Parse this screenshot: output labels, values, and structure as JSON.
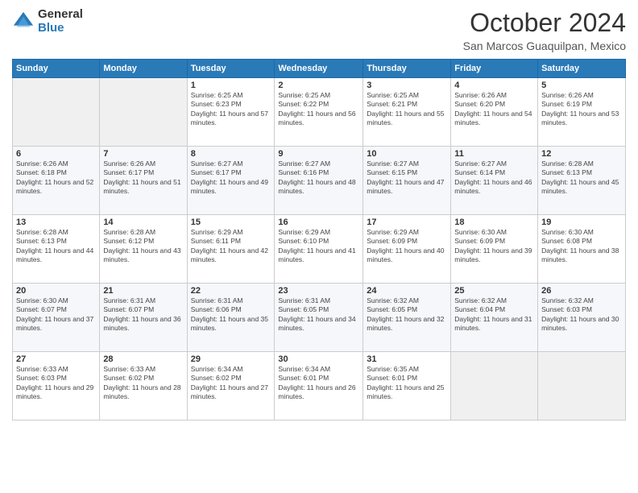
{
  "logo": {
    "general": "General",
    "blue": "Blue"
  },
  "title": "October 2024",
  "location": "San Marcos Guaquilpan, Mexico",
  "weekdays": [
    "Sunday",
    "Monday",
    "Tuesday",
    "Wednesday",
    "Thursday",
    "Friday",
    "Saturday"
  ],
  "weeks": [
    [
      {
        "day": "",
        "sunrise": "",
        "sunset": "",
        "daylight": ""
      },
      {
        "day": "",
        "sunrise": "",
        "sunset": "",
        "daylight": ""
      },
      {
        "day": "1",
        "sunrise": "Sunrise: 6:25 AM",
        "sunset": "Sunset: 6:23 PM",
        "daylight": "Daylight: 11 hours and 57 minutes."
      },
      {
        "day": "2",
        "sunrise": "Sunrise: 6:25 AM",
        "sunset": "Sunset: 6:22 PM",
        "daylight": "Daylight: 11 hours and 56 minutes."
      },
      {
        "day": "3",
        "sunrise": "Sunrise: 6:25 AM",
        "sunset": "Sunset: 6:21 PM",
        "daylight": "Daylight: 11 hours and 55 minutes."
      },
      {
        "day": "4",
        "sunrise": "Sunrise: 6:26 AM",
        "sunset": "Sunset: 6:20 PM",
        "daylight": "Daylight: 11 hours and 54 minutes."
      },
      {
        "day": "5",
        "sunrise": "Sunrise: 6:26 AM",
        "sunset": "Sunset: 6:19 PM",
        "daylight": "Daylight: 11 hours and 53 minutes."
      }
    ],
    [
      {
        "day": "6",
        "sunrise": "Sunrise: 6:26 AM",
        "sunset": "Sunset: 6:18 PM",
        "daylight": "Daylight: 11 hours and 52 minutes."
      },
      {
        "day": "7",
        "sunrise": "Sunrise: 6:26 AM",
        "sunset": "Sunset: 6:17 PM",
        "daylight": "Daylight: 11 hours and 51 minutes."
      },
      {
        "day": "8",
        "sunrise": "Sunrise: 6:27 AM",
        "sunset": "Sunset: 6:17 PM",
        "daylight": "Daylight: 11 hours and 49 minutes."
      },
      {
        "day": "9",
        "sunrise": "Sunrise: 6:27 AM",
        "sunset": "Sunset: 6:16 PM",
        "daylight": "Daylight: 11 hours and 48 minutes."
      },
      {
        "day": "10",
        "sunrise": "Sunrise: 6:27 AM",
        "sunset": "Sunset: 6:15 PM",
        "daylight": "Daylight: 11 hours and 47 minutes."
      },
      {
        "day": "11",
        "sunrise": "Sunrise: 6:27 AM",
        "sunset": "Sunset: 6:14 PM",
        "daylight": "Daylight: 11 hours and 46 minutes."
      },
      {
        "day": "12",
        "sunrise": "Sunrise: 6:28 AM",
        "sunset": "Sunset: 6:13 PM",
        "daylight": "Daylight: 11 hours and 45 minutes."
      }
    ],
    [
      {
        "day": "13",
        "sunrise": "Sunrise: 6:28 AM",
        "sunset": "Sunset: 6:13 PM",
        "daylight": "Daylight: 11 hours and 44 minutes."
      },
      {
        "day": "14",
        "sunrise": "Sunrise: 6:28 AM",
        "sunset": "Sunset: 6:12 PM",
        "daylight": "Daylight: 11 hours and 43 minutes."
      },
      {
        "day": "15",
        "sunrise": "Sunrise: 6:29 AM",
        "sunset": "Sunset: 6:11 PM",
        "daylight": "Daylight: 11 hours and 42 minutes."
      },
      {
        "day": "16",
        "sunrise": "Sunrise: 6:29 AM",
        "sunset": "Sunset: 6:10 PM",
        "daylight": "Daylight: 11 hours and 41 minutes."
      },
      {
        "day": "17",
        "sunrise": "Sunrise: 6:29 AM",
        "sunset": "Sunset: 6:09 PM",
        "daylight": "Daylight: 11 hours and 40 minutes."
      },
      {
        "day": "18",
        "sunrise": "Sunrise: 6:30 AM",
        "sunset": "Sunset: 6:09 PM",
        "daylight": "Daylight: 11 hours and 39 minutes."
      },
      {
        "day": "19",
        "sunrise": "Sunrise: 6:30 AM",
        "sunset": "Sunset: 6:08 PM",
        "daylight": "Daylight: 11 hours and 38 minutes."
      }
    ],
    [
      {
        "day": "20",
        "sunrise": "Sunrise: 6:30 AM",
        "sunset": "Sunset: 6:07 PM",
        "daylight": "Daylight: 11 hours and 37 minutes."
      },
      {
        "day": "21",
        "sunrise": "Sunrise: 6:31 AM",
        "sunset": "Sunset: 6:07 PM",
        "daylight": "Daylight: 11 hours and 36 minutes."
      },
      {
        "day": "22",
        "sunrise": "Sunrise: 6:31 AM",
        "sunset": "Sunset: 6:06 PM",
        "daylight": "Daylight: 11 hours and 35 minutes."
      },
      {
        "day": "23",
        "sunrise": "Sunrise: 6:31 AM",
        "sunset": "Sunset: 6:05 PM",
        "daylight": "Daylight: 11 hours and 34 minutes."
      },
      {
        "day": "24",
        "sunrise": "Sunrise: 6:32 AM",
        "sunset": "Sunset: 6:05 PM",
        "daylight": "Daylight: 11 hours and 32 minutes."
      },
      {
        "day": "25",
        "sunrise": "Sunrise: 6:32 AM",
        "sunset": "Sunset: 6:04 PM",
        "daylight": "Daylight: 11 hours and 31 minutes."
      },
      {
        "day": "26",
        "sunrise": "Sunrise: 6:32 AM",
        "sunset": "Sunset: 6:03 PM",
        "daylight": "Daylight: 11 hours and 30 minutes."
      }
    ],
    [
      {
        "day": "27",
        "sunrise": "Sunrise: 6:33 AM",
        "sunset": "Sunset: 6:03 PM",
        "daylight": "Daylight: 11 hours and 29 minutes."
      },
      {
        "day": "28",
        "sunrise": "Sunrise: 6:33 AM",
        "sunset": "Sunset: 6:02 PM",
        "daylight": "Daylight: 11 hours and 28 minutes."
      },
      {
        "day": "29",
        "sunrise": "Sunrise: 6:34 AM",
        "sunset": "Sunset: 6:02 PM",
        "daylight": "Daylight: 11 hours and 27 minutes."
      },
      {
        "day": "30",
        "sunrise": "Sunrise: 6:34 AM",
        "sunset": "Sunset: 6:01 PM",
        "daylight": "Daylight: 11 hours and 26 minutes."
      },
      {
        "day": "31",
        "sunrise": "Sunrise: 6:35 AM",
        "sunset": "Sunset: 6:01 PM",
        "daylight": "Daylight: 11 hours and 25 minutes."
      },
      {
        "day": "",
        "sunrise": "",
        "sunset": "",
        "daylight": ""
      },
      {
        "day": "",
        "sunrise": "",
        "sunset": "",
        "daylight": ""
      }
    ]
  ]
}
